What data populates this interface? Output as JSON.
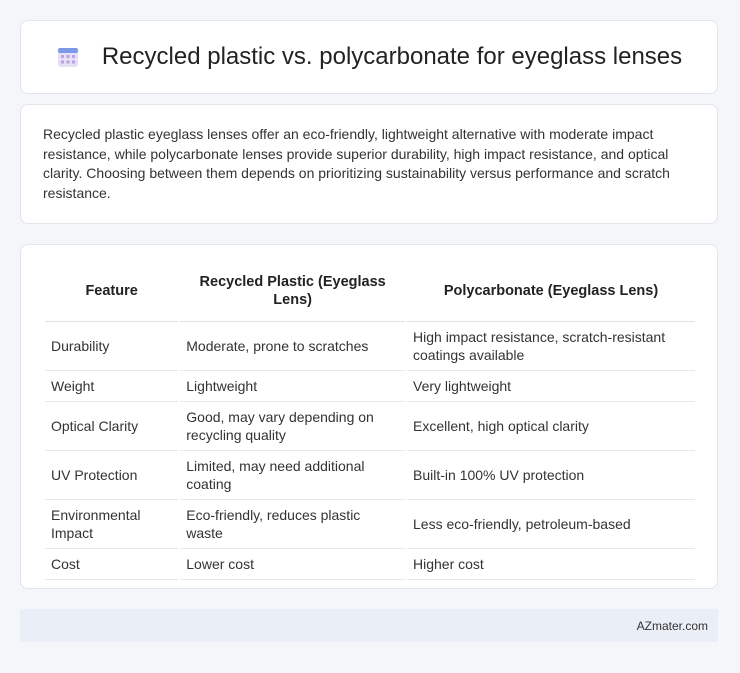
{
  "header": {
    "title": "Recycled plastic vs. polycarbonate for eyeglass lenses",
    "icon": "calendar-grid-icon"
  },
  "description": "Recycled plastic eyeglass lenses offer an eco-friendly, lightweight alternative with moderate impact resistance, while polycarbonate lenses provide superior durability, high impact resistance, and optical clarity. Choosing between them depends on prioritizing sustainability versus performance and scratch resistance.",
  "table": {
    "headers": [
      "Feature",
      "Recycled Plastic (Eyeglass Lens)",
      "Polycarbonate (Eyeglass Lens)"
    ],
    "rows": [
      [
        "Durability",
        "Moderate, prone to scratches",
        "High impact resistance, scratch-resistant coatings available"
      ],
      [
        "Weight",
        "Lightweight",
        "Very lightweight"
      ],
      [
        "Optical Clarity",
        "Good, may vary depending on recycling quality",
        "Excellent, high optical clarity"
      ],
      [
        "UV Protection",
        "Limited, may need additional coating",
        "Built-in 100% UV protection"
      ],
      [
        "Environmental Impact",
        "Eco-friendly, reduces plastic waste",
        "Less eco-friendly, petroleum-based"
      ],
      [
        "Cost",
        "Lower cost",
        "Higher cost"
      ]
    ]
  },
  "footer": {
    "brand": "AZmater.com"
  },
  "colors": {
    "icon_accent": "#6b8fe0",
    "icon_light": "#c7b3ec",
    "footer_bg": "#e9eef7"
  }
}
